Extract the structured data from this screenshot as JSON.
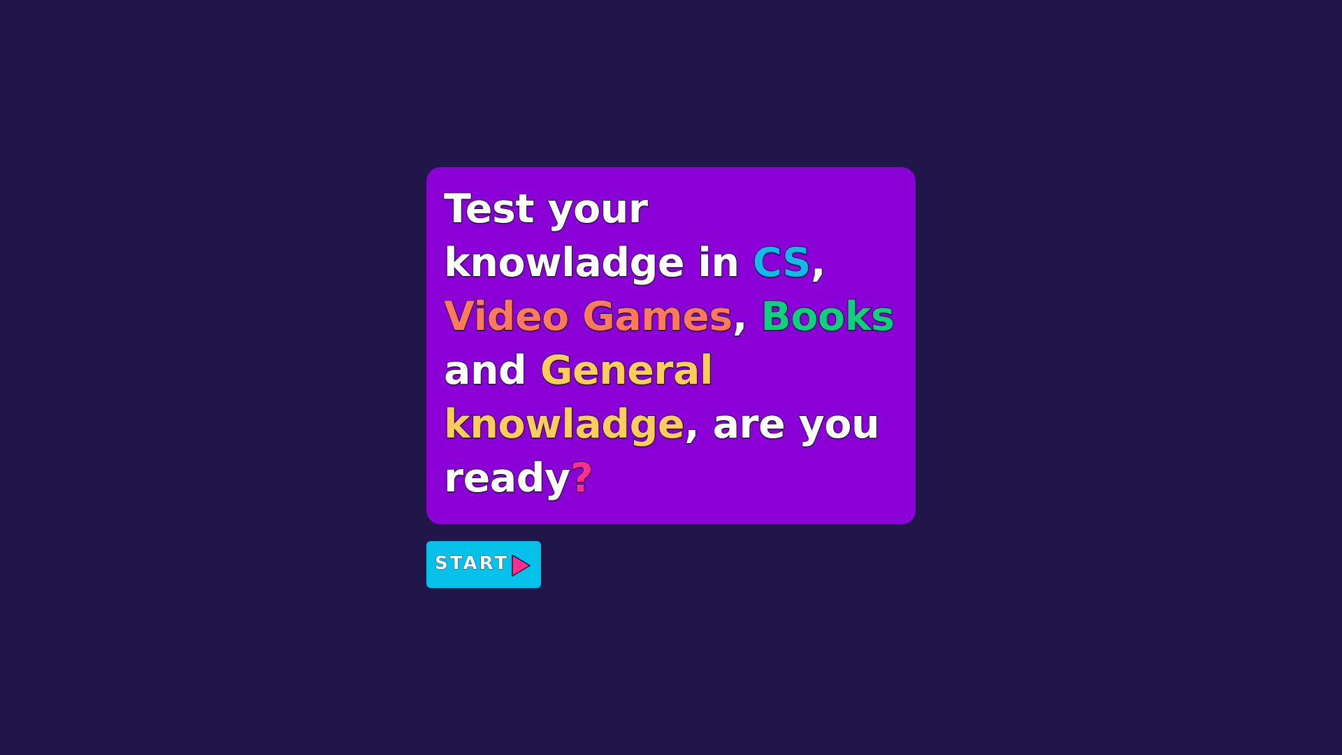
{
  "headline": {
    "segments": [
      "Test your knowladge in ",
      "CS",
      ", ",
      "Video Games",
      ", ",
      "Books",
      " and ",
      "General knowladge",
      ", are you ready",
      "?"
    ]
  },
  "start_button": {
    "label": "START",
    "icon": "play-icon"
  },
  "colors": {
    "background": "#21164a",
    "card": "#8b00d6",
    "button": "#06c1ea",
    "accent_cs": "#16b8e8",
    "accent_games": "#ff7a5c",
    "accent_books": "#10cf7e",
    "accent_general": "#ffcc5c",
    "accent_question": "#ff2f8f"
  }
}
